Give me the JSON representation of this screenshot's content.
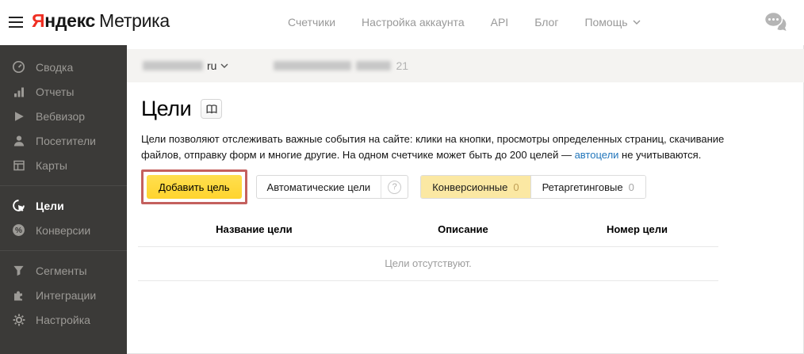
{
  "topbar": {
    "logo": {
      "yandex_red": "Я",
      "yandex_black": "ндекс",
      "product": "Метрика"
    },
    "nav": {
      "counters": "Счетчики",
      "account_settings": "Настройка аккаунта",
      "api": "API",
      "blog": "Блог",
      "help": "Помощь"
    }
  },
  "breadcrumb": {
    "site_tld": "ru",
    "counter_suffix": "21"
  },
  "sidebar": {
    "items": [
      {
        "label": "Сводка",
        "icon": "gauge-icon",
        "active": false
      },
      {
        "label": "Отчеты",
        "icon": "bar-chart-icon",
        "active": false
      },
      {
        "label": "Вебвизор",
        "icon": "play-icon",
        "active": false
      },
      {
        "label": "Посетители",
        "icon": "person-icon",
        "active": false
      },
      {
        "label": "Карты",
        "icon": "layout-icon",
        "active": false
      },
      {
        "label": "Цели",
        "icon": "goal-icon",
        "active": true
      },
      {
        "label": "Конверсии",
        "icon": "percent-icon",
        "active": false
      },
      {
        "label": "Сегменты",
        "icon": "funnel-icon",
        "active": false
      },
      {
        "label": "Интеграции",
        "icon": "puzzle-icon",
        "active": false
      },
      {
        "label": "Настройка",
        "icon": "gear-icon",
        "active": false
      }
    ]
  },
  "main": {
    "title": "Цели",
    "description_part1": "Цели позволяют отслеживать важные события на сайте: клики на кнопки, просмотры определенных страниц, скачивание файлов, отправку форм и многие другие. На одном счетчике может быть до 200 целей — ",
    "description_link": "автоцели",
    "description_part2": " не учитываются.",
    "buttons": {
      "add_goal": "Добавить цель",
      "auto_goals": "Автоматические цели",
      "question_mark": "?",
      "conversion": "Конверсионные",
      "conversion_count": "0",
      "retargeting": "Ретаргетинговые",
      "retargeting_count": "0"
    },
    "table": {
      "headers": [
        "Название цели",
        "Описание",
        "Номер цели"
      ],
      "empty_text": "Цели отсутствуют."
    }
  },
  "colors": {
    "brand_red": "#ef2e22",
    "accent_yellow": "#ffd93d",
    "selected_yellow": "#fbe8a3",
    "annotation_red": "#c4605e",
    "link_blue": "#2276bb",
    "sidebar_bg": "#3b3a38"
  }
}
